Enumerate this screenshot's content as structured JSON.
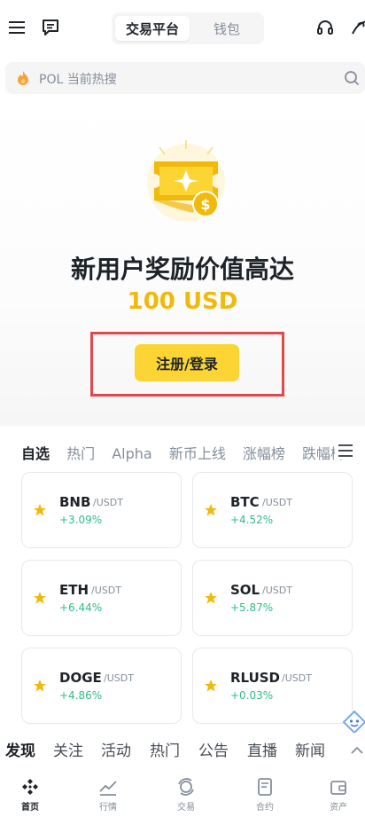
{
  "header": {
    "segments": [
      {
        "label": "交易平台",
        "active": true
      },
      {
        "label": "钱包",
        "active": false
      }
    ],
    "icons": [
      "menu-icon",
      "chat-icon",
      "headset-icon",
      "link-icon"
    ]
  },
  "search": {
    "placeholder": "POL 当前热搜",
    "icon": "fire-icon"
  },
  "promo": {
    "title": "新用户奖励价值高达",
    "amount": "100 USD",
    "cta": "注册/登录"
  },
  "market": {
    "tabs": [
      "自选",
      "热门",
      "Alpha",
      "新币上线",
      "涨幅榜",
      "跌幅榜"
    ],
    "cards": [
      {
        "symbol": "BNB",
        "quote": "/USDT",
        "change": "+3.09%"
      },
      {
        "symbol": "BTC",
        "quote": "/USDT",
        "change": "+4.52%"
      },
      {
        "symbol": "ETH",
        "quote": "/USDT",
        "change": "+6.44%"
      },
      {
        "symbol": "SOL",
        "quote": "/USDT",
        "change": "+5.87%"
      },
      {
        "symbol": "DOGE",
        "quote": "/USDT",
        "change": "+4.86%"
      },
      {
        "symbol": "RLUSD",
        "quote": "/USDT",
        "change": "+0.03%"
      }
    ]
  },
  "feed": {
    "tabs": [
      "发现",
      "关注",
      "活动",
      "热门",
      "公告",
      "直播",
      "新闻"
    ]
  },
  "bottom_nav": [
    {
      "label": "首页",
      "icon": "home-icon",
      "active": true
    },
    {
      "label": "行情",
      "icon": "markets-icon",
      "active": false
    },
    {
      "label": "交易",
      "icon": "trade-icon",
      "active": false
    },
    {
      "label": "合约",
      "icon": "futures-icon",
      "active": false
    },
    {
      "label": "资产",
      "icon": "wallet-icon",
      "active": false
    }
  ],
  "colors": {
    "brand": "#f0b90b",
    "button": "#fcd535",
    "up": "#2ebd85",
    "highlight": "#e0484b"
  }
}
